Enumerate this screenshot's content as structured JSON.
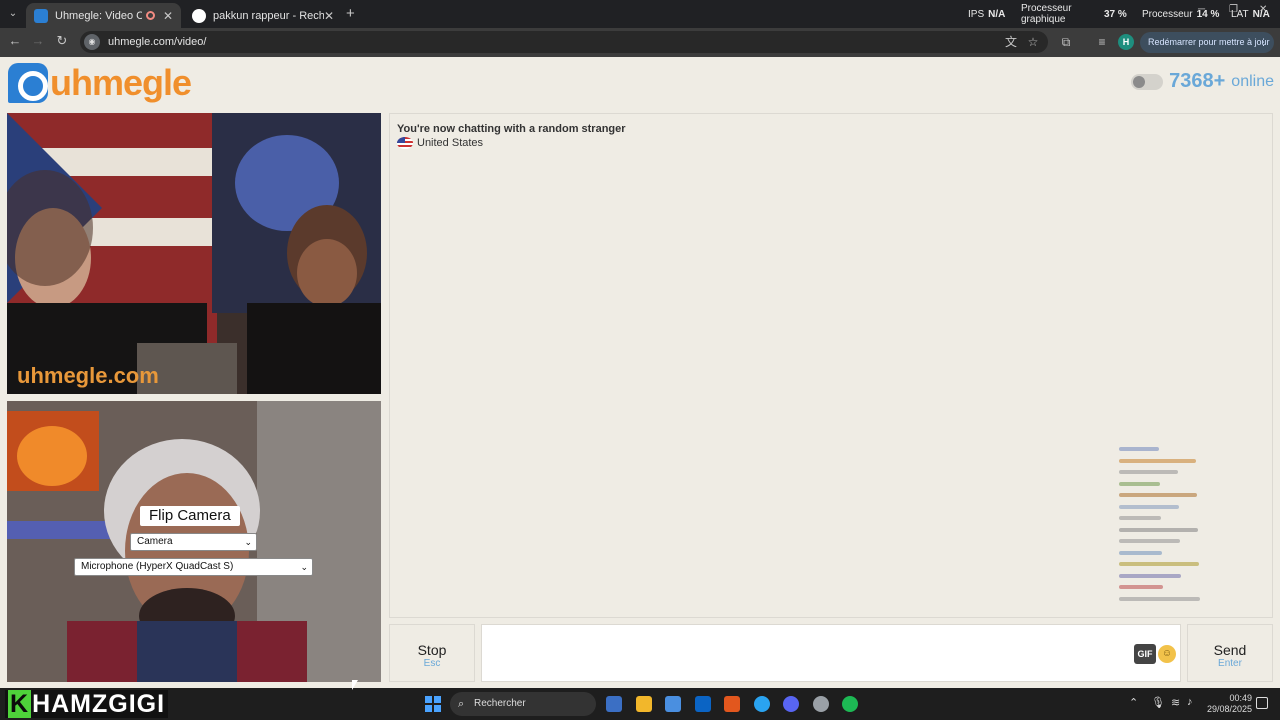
{
  "browser": {
    "tabs": [
      {
        "title": "Uhmegle: Video Chat | Ome",
        "close": "✕"
      },
      {
        "title": "pakkun rappeur - Recherche G",
        "close": "✕"
      }
    ],
    "new_tab": "+",
    "url": "uhmegle.com/video/",
    "restart_label": "Redémarrer pour mettre à jour",
    "perf": {
      "ips_label": "IPS",
      "ips_value": "N/A",
      "gpu_label": "Processeur graphique",
      "gpu_value": "37 %",
      "cpu_label": "Processeur",
      "cpu_value": "14 %",
      "lat_label": "LAT",
      "lat_value": "N/A"
    },
    "profile_initial": "H",
    "icons": [
      "back-icon",
      "forward-icon",
      "reload-icon",
      "translate-icon",
      "star-icon",
      "extensions-icon",
      "media-icon",
      "menu-icon"
    ]
  },
  "site": {
    "logo_text": "uhmegle",
    "online_count": "7368+",
    "online_label": "online"
  },
  "video": {
    "watermark": "uhmegle.com",
    "flip_camera": "Flip Camera",
    "camera_select": "Camera",
    "mic_select": "Microphone (HyperX QuadCast S)"
  },
  "chat": {
    "status": "You're now chatting with a random stranger",
    "country": "United States",
    "overlay_colors": [
      "#7a8fbf",
      "#c98a3a",
      "#9a9a9a",
      "#7aa05a",
      "#b07a3a",
      "#8aa0c0",
      "#9a9a9a",
      "#8a8a8a",
      "#9a9a9a",
      "#7a9ac0",
      "#b0a03a",
      "#7a7ab0",
      "#c05a5a",
      "#9a9a9a"
    ]
  },
  "controls": {
    "stop_label": "Stop",
    "stop_key": "Esc",
    "send_label": "Send",
    "send_key": "Enter",
    "gif_label": "GIF",
    "emoji_icon": "smiley-icon"
  },
  "taskbar": {
    "streamer_first": "K",
    "streamer_rest": "HAMZGIGI",
    "search_placeholder": "Rechercher",
    "time": "00:49",
    "date": "29/08/2025",
    "app_colors": [
      "#3b6fc4",
      "#f2b72b",
      "#4a8fe0",
      "#0b64c4",
      "#e2571e",
      "#2aa3f0",
      "#5865f2",
      "#9aa0a6",
      "#1db954"
    ]
  },
  "colors": {
    "brand_orange": "#f08f2c",
    "brand_blue": "#2b7fd3",
    "accent_blue": "#6aa8d8"
  }
}
